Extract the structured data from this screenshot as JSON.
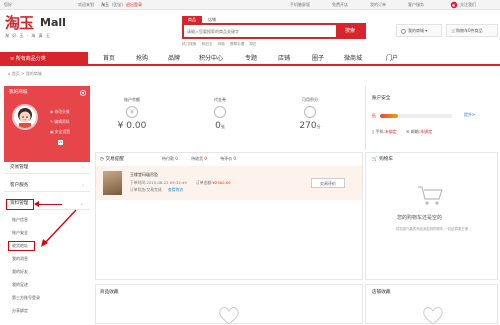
{
  "topbar": {
    "left": "您好",
    "welcome": "欢迎来到",
    "site_name": "淘玉",
    "tag": "(团宝)",
    "logout": "退出登录",
    "right_items": [
      "手机触屏版",
      "免费开店",
      "我的订单",
      "客户服务"
    ],
    "follow": "关注我们"
  },
  "header": {
    "logo_cn": "淘玉",
    "logo_mall": "Mall",
    "logo_sub": "淘 好 玉 · 淘 真 玉",
    "search_tabs": [
      "商品",
      "店铺"
    ],
    "search_placeholder": "请输入您要搜索的商品关键字",
    "search_button": "搜索",
    "hot_words": [
      "热门搜索",
      "和田玉",
      "玛瑙",
      "翡翠手镯",
      "原石"
    ],
    "my_mall": "我的商城",
    "cart": "购物车0件商品"
  },
  "nav": {
    "categories": "所有商品分类",
    "items": [
      "首页",
      "抢购",
      "品牌",
      "积分中心",
      "专题",
      "店铺",
      "圈子",
      "微商城",
      "门户"
    ]
  },
  "breadcrumb": "首页 > 我的商城",
  "sidebar": {
    "title": "我的商城",
    "links": [
      "修改头像",
      "编辑资料",
      "安全设置"
    ],
    "badge": "V1",
    "sections": [
      {
        "title": "交易管理",
        "state": "collapsed"
      },
      {
        "title": "客户服务",
        "state": "collapsed"
      },
      {
        "title": "资料管理",
        "state": "expanded"
      }
    ],
    "sub_items": [
      "账户信息",
      "账户安全",
      "收货地址",
      "我的消息",
      "我的好友",
      "我的足迹",
      "第三方账号登录",
      "分享绑定"
    ]
  },
  "stats": [
    {
      "label": "账户余额",
      "value": "0.00",
      "prefix": "¥",
      "icon": "yen-icon"
    },
    {
      "label": "代金券",
      "value": "0",
      "unit": "张",
      "icon": "coupon-icon"
    },
    {
      "label": "可用积分",
      "value": "270",
      "unit": "分",
      "icon": "points-icon"
    }
  ],
  "security": {
    "title": "账户安全",
    "level_label": "低",
    "improve_link": "提升>",
    "phone_label": "手机:",
    "phone_status": "未绑定",
    "email_label": "邮箱:",
    "email_status": "未绑定",
    "level_fraction": 0.25
  },
  "orders": {
    "title": "交易提醒",
    "tabs": [
      "待付款",
      "待收货",
      "待评价"
    ],
    "tab_counts": [
      "0",
      "0",
      "0"
    ],
    "item_name": "玉缘堂玛瑙吊坠",
    "order_time_label": "下单时间:",
    "order_time": "2015-08-22 09:32:49",
    "status_label": "订单状态:",
    "status": "交易完成",
    "action_link": "查看物流",
    "amount_label": "订单金额:",
    "amount": "¥2500.00",
    "button": "交易评价"
  },
  "cart_panel": {
    "title": "购物车",
    "empty_title": "您的购物车还是空的",
    "empty_sub": "将您感兴趣的商品添加到购物车,一站结算更方便"
  },
  "collect_panel": {
    "title": "商品收藏"
  },
  "store_panel": {
    "title": "店铺收藏"
  },
  "colors": {
    "accent": "#d8252c",
    "sidebar": "#e6454a",
    "annotation": "#e0000b"
  }
}
